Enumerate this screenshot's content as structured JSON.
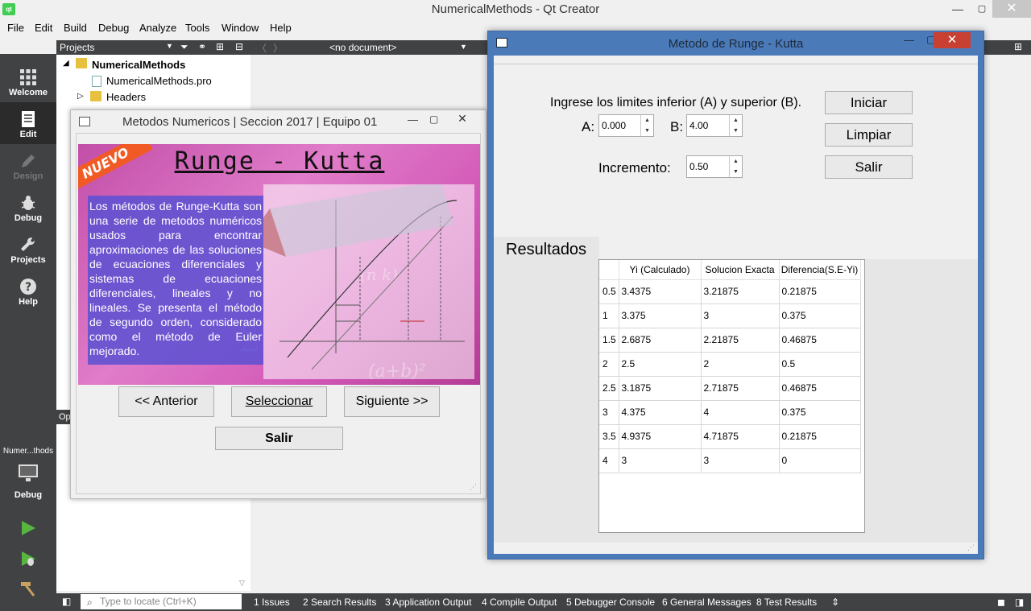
{
  "window": {
    "title": "NumericalMethods - Qt Creator",
    "logo": "qt",
    "min": "—",
    "max": "▢",
    "close": "✕"
  },
  "menu": [
    "File",
    "Edit",
    "Build",
    "Debug",
    "Analyze",
    "Tools",
    "Window",
    "Help"
  ],
  "modes": [
    {
      "label": "Welcome",
      "icon": "grid-icon"
    },
    {
      "label": "Edit",
      "icon": "document-icon"
    },
    {
      "label": "Design",
      "icon": "pencil-icon"
    },
    {
      "label": "Debug",
      "icon": "bug-icon"
    },
    {
      "label": "Projects",
      "icon": "wrench-icon"
    },
    {
      "label": "Help",
      "icon": "help-icon"
    }
  ],
  "target": {
    "project": "Numer...thods",
    "config": "Debug"
  },
  "projects": {
    "header": "Projects",
    "root": "NumericalMethods",
    "pro_file": "NumericalMethods.pro",
    "headers": "Headers",
    "op_label": "Op"
  },
  "editor": {
    "document": "<no document>"
  },
  "statusbar": {
    "locate_placeholder": "Type to locate (Ctrl+K)",
    "panes": [
      "1  Issues",
      "2  Search Results",
      "3  Application Output",
      "4  Compile Output",
      "5  Debugger Console",
      "6  General Messages",
      "8  Test Results"
    ]
  },
  "dialog1": {
    "title": "Metodos Numericos | Seccion 2017 | Equipo 01",
    "min": "—",
    "max": "▢",
    "close": "✕",
    "ribbon": "NUEVO",
    "banner_title": "Runge - Kutta",
    "description": "Los métodos de Runge-Kutta son una serie de metodos numéricos usados para encontrar aproximaciones de las soluciones de ecuaciones diferenciales y sistemas de ecuaciones diferenciales, lineales y no lineales. Se presenta el método de segundo orden, considerado como el método de Euler mejorado.",
    "buttons": {
      "prev": "<< Anterior",
      "select": "Seleccionar",
      "next": "Siguiente >>",
      "exit": "Salir"
    }
  },
  "dialog2": {
    "title": "Metodo de Runge - Kutta",
    "min": "—",
    "max": "▢",
    "close": "✕",
    "prompt": "Ingrese los limites inferior (A) y superior (B).",
    "a_label": "A:",
    "a_value": "0.000",
    "b_label": "B:",
    "b_value": "4.00",
    "inc_label": "Incremento:",
    "inc_value": "0.50",
    "buttons": {
      "start": "Iniciar",
      "clear": "Limpiar",
      "exit": "Salir"
    },
    "results_tab": "Resultados",
    "table": {
      "headers": [
        "Yi (Calculado)",
        "Solucion Exacta",
        "Diferencia(S.E-Yi)"
      ],
      "rows": [
        {
          "x": "0.5",
          "yi": "3.4375",
          "exact": "3.21875",
          "diff": "0.21875"
        },
        {
          "x": "1",
          "yi": "3.375",
          "exact": "3",
          "diff": "0.375"
        },
        {
          "x": "1.5",
          "yi": "2.6875",
          "exact": "2.21875",
          "diff": "0.46875"
        },
        {
          "x": "2",
          "yi": "2.5",
          "exact": "2",
          "diff": "0.5"
        },
        {
          "x": "2.5",
          "yi": "3.1875",
          "exact": "2.71875",
          "diff": "0.46875"
        },
        {
          "x": "3",
          "yi": "4.375",
          "exact": "4",
          "diff": "0.375"
        },
        {
          "x": "3.5",
          "yi": "4.9375",
          "exact": "4.71875",
          "diff": "0.21875"
        },
        {
          "x": "4",
          "yi": "3",
          "exact": "3",
          "diff": "0"
        }
      ]
    }
  }
}
